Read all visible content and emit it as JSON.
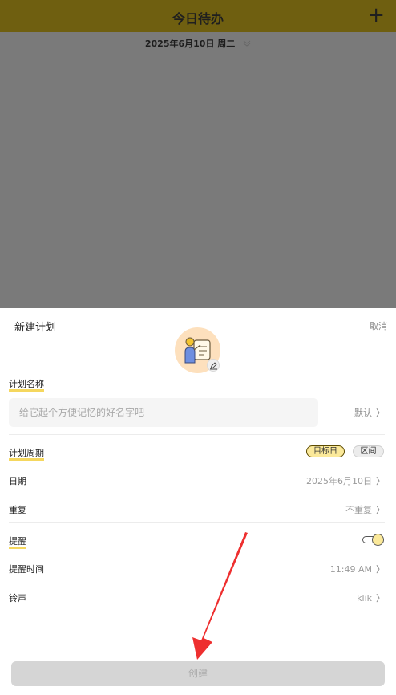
{
  "header": {
    "title": "今日待办",
    "add_icon": "plus-icon"
  },
  "date_bar": {
    "date": "2025年6月10日 周二",
    "expand_icon": "chevron-double-down-icon"
  },
  "sheet": {
    "title": "新建计划",
    "cancel_label": "取消",
    "plan_name": {
      "label": "计划名称",
      "placeholder": "给它起个方便记忆的好名字吧",
      "value": "",
      "default_label": "默认"
    },
    "plan_cycle": {
      "label": "计划周期",
      "segments": [
        "目标日",
        "区间"
      ],
      "selected": "目标日",
      "date": {
        "label": "日期",
        "value": "2025年6月10日"
      },
      "repeat": {
        "label": "重复",
        "value": "不重复"
      }
    },
    "reminder": {
      "label": "提醒",
      "enabled": true,
      "time": {
        "label": "提醒时间",
        "value": "11:49 AM"
      },
      "ringtone": {
        "label": "铃声",
        "value": "klik"
      }
    },
    "create_label": "创建"
  },
  "colors": {
    "accent": "#f4d34c",
    "header_bg": "#6f5f10",
    "overlay": "#7a7a7a",
    "annotation_arrow": "#ee2f2f"
  }
}
